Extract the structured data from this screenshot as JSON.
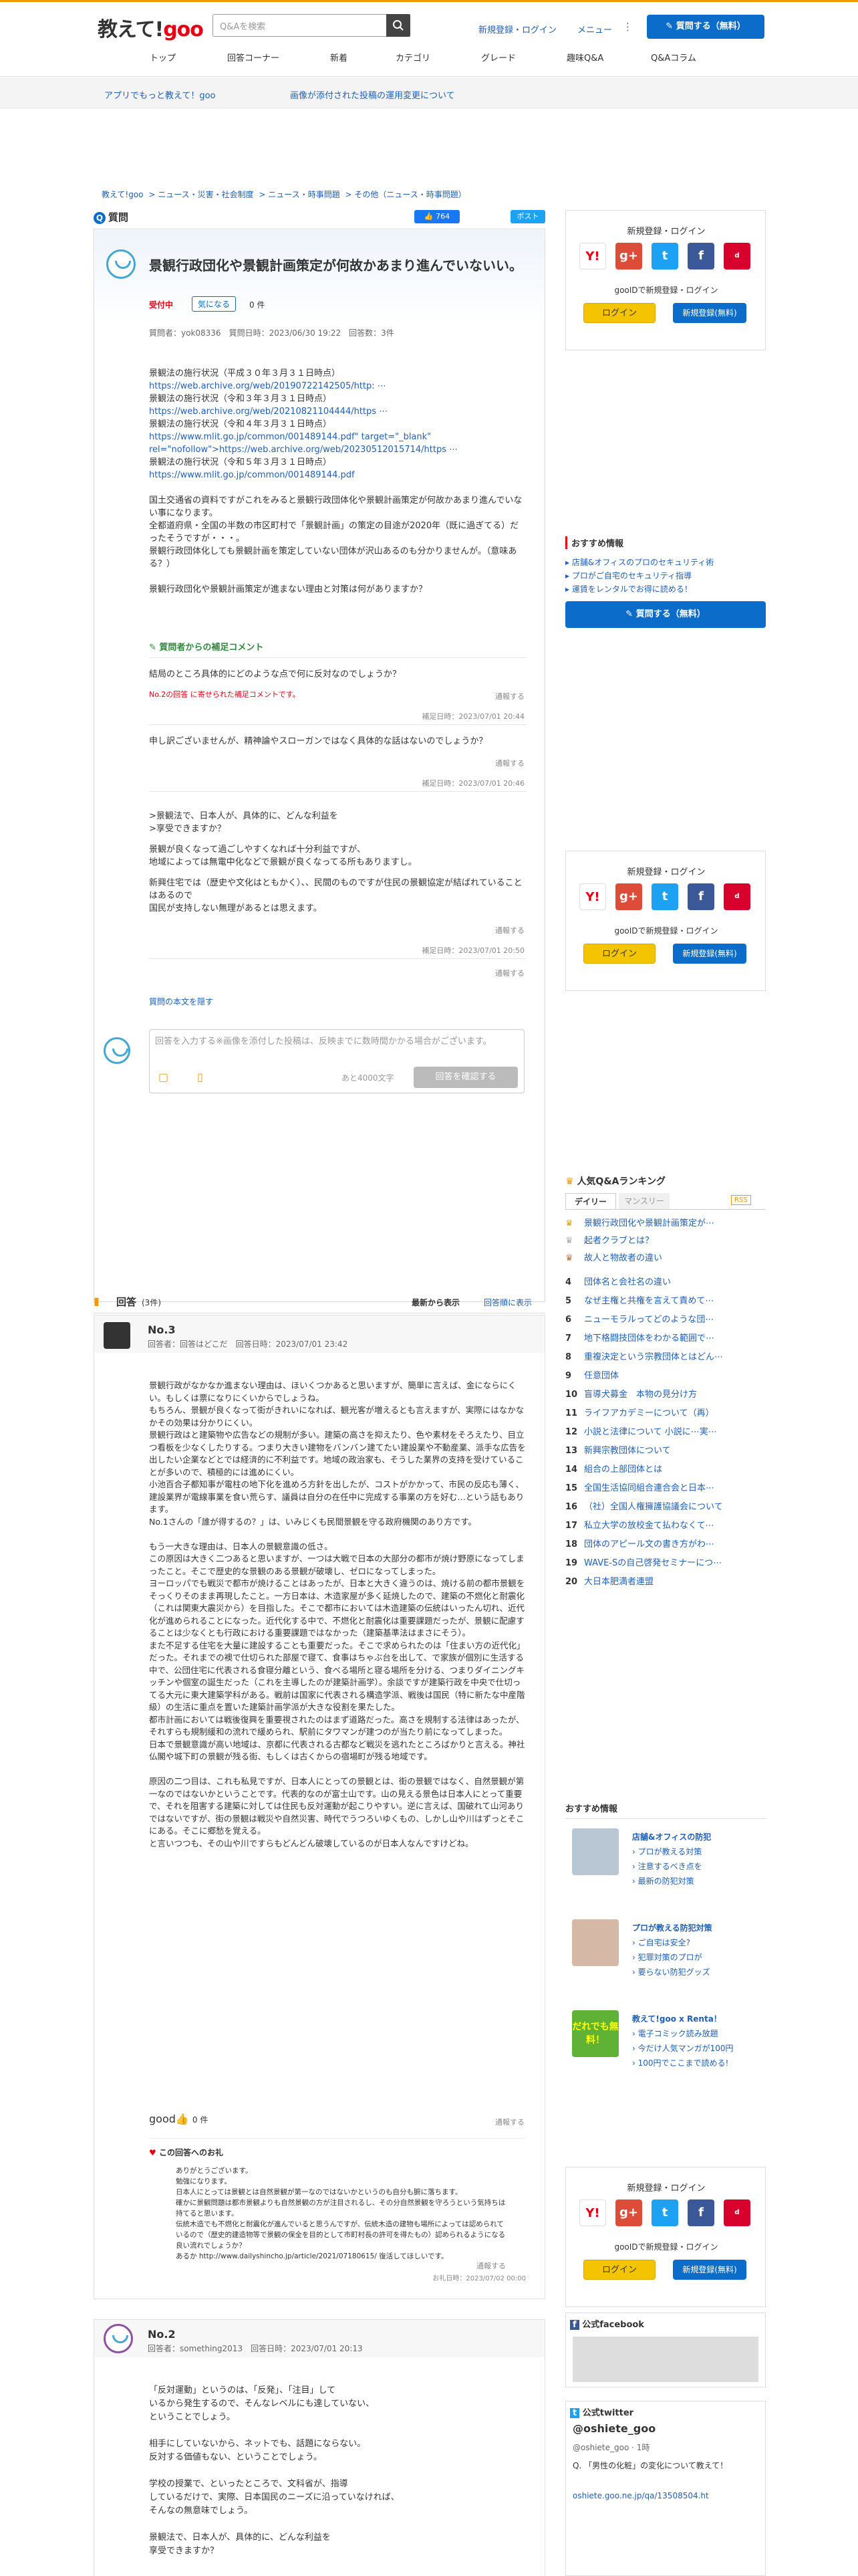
{
  "header": {
    "logo_text": "教えて!",
    "logo_goo": "goo",
    "search_placeholder": "Q&Aを検索",
    "register": "新規登録・ログイン",
    "menu": "メニュー",
    "ask_button": "質問する（無料）"
  },
  "nav": [
    "トップ",
    "回答コーナー",
    "新着",
    "カテゴリ",
    "グレード",
    "趣味Q&A",
    "Q&Aコラム"
  ],
  "subbar": {
    "app": "アプリでもっと教えて！goo",
    "notice": "画像が添付された投稿の運用変更について"
  },
  "breadcrumb": [
    "教えて!goo",
    "ニュース・災害・社会制度",
    "ニュース・時事問題",
    "その他（ニュース・時事問題）"
  ],
  "question": {
    "label": "質問",
    "like_count": "764",
    "share": "ポスト",
    "title": "景観行政団化や景観計画策定が何故かあまり進んでいないい。",
    "status": "受付中",
    "follow": "気になる",
    "follow_count": "0 件",
    "meta": "質問者：yok08336　質問日時：2023/06/30 19:22　回答数：3件",
    "body": [
      "景観法の施行状況（平成３０年３月３１日時点）",
      "https://web.archive.org/web/20190722142505/http: ⋯",
      "景観法の施行状況（令和３年３月３１日時点）",
      "https://web.archive.org/web/20210821104444/https ⋯",
      "景観法の施行状況（令和４年３月３１日時点）",
      "https://www.mlit.go.jp/common/001489144.pdf\" target=\"_blank\" rel=\"nofollow\">https://web.archive.org/web/20230512015714/https ⋯",
      "景観法の施行状況（令和５年３月３１日時点）",
      "https://www.mlit.go.jp/common/001489144.pdf",
      "",
      "国土交通省の資料ですがこれをみると景観行政団体化や景観計画策定が何故かあまり進んでいない事になります。",
      "全都道府県・全国の半数の市区町村で「景観計画」の策定の目途が2020年（既に過ぎてる）だったそうですが・・・。",
      "景観行政団体化しても景観計画を策定していない団体が沢山あるのも分かりませんが。（意味ある？）",
      "",
      "景観行政団化や景観計画策定が進まない理由と対策は何がありますか？"
    ],
    "supplement_title": "質問者からの補足コメント",
    "supp1": "結局のところ具体的にどのような点で何に反対なのでしょうか？",
    "supp1_note": "No.2の回答 に寄せられた補足コメントです。",
    "report": "通報する",
    "date1": "補足日時：2023/07/01 20:44",
    "supp2": "申し訳ございませんが、精神論やスローガンではなく具体的な話はないのでしょうか？",
    "date2": "補足日時：2023/07/01 20:46",
    "supp3": [
      ">景観法で、日本人が、具体的に、どんな利益を",
      ">享受できますか？",
      "",
      "景観が良くなって過ごしやすくなれば十分利益ですが、",
      "地域によっては無電中化などで景観が良くなってる所もありますし。",
      "",
      "新興住宅では（歴史や文化はともかく）、、民間のものですが住民の景観協定が結ばれていることはあるので",
      "国民が支持しない無理があるとは思えます。"
    ],
    "date3": "補足日時：2023/07/01 20:50",
    "copy_link": "質問の本文を隠す",
    "answer_placeholder": "回答を入力する※画像を添付した投稿は、反映までに数時間かかる場合がございます。",
    "char_count": "あと4000文字",
    "answer_button": "回答を確認する"
  },
  "sidebar": {
    "login_title": "新規登録・ログイン",
    "gooid": "gooIDで新規登録・ログイン",
    "login": "ログイン",
    "register": "新規登録(無料)",
    "recommend_title": "おすすめ情報",
    "recommend": [
      "店舗&オフィスのプロのセキュリティ術",
      "プロがご自宅のセキュリティ指導",
      "運賃をレンタルでお得に読める！"
    ],
    "ask_button": "質問する（無料）",
    "ranking_title": "人気Q&Aランキング",
    "tab_daily": "デイリー",
    "tab_monthly": "マンスリー",
    "rss": "RSS",
    "ranking": [
      "景観行政団化や景観計画策定が⋯",
      "起者クラブとは？",
      "故人と物故者の違い",
      "団体名と会社名の違い",
      "なぜ主権と共権を言えて責めて⋯",
      "ニューモラルってどのような団⋯",
      "地下格闘技団体をわかる範囲で⋯",
      "重複決定という宗教団体とはどん⋯",
      "任意団体",
      "盲導犬募金　本物の見分け方",
      "ライフアカデミーについて（再）",
      "小説と法律について 小説に⋯実⋯",
      "新興宗教団体について",
      "組合の上部団体とは",
      "全国生活協同組合連合会と日本⋯",
      "（社）全国人権擁護協議会について",
      "私立大学の放校金て払わなくて⋯",
      "団体のアピール文の書き方がわ⋯",
      "WAVE-Sの自己啓発セミナーにつ⋯",
      "大日本肥満者連盟"
    ],
    "info_title": "おすすめ情報",
    "info": [
      {
        "head": "店舗&オフィスの防犯",
        "items": [
          "プロが教える対策",
          "注意するべき点を",
          "最新の防犯対策"
        ]
      },
      {
        "head": "プロが教える防犯対策",
        "items": [
          "ご自宅は安全?",
          "犯罪対策のプロが",
          "要らない防犯グッズ"
        ]
      },
      {
        "head": "教えて!goo x Renta！",
        "items": [
          "電子コミック読み放題",
          "今だけ人気マンガが100円",
          "100円でここまで読める!"
        ]
      }
    ],
    "ad_badge": "だれでも無料！",
    "fb_title": "公式facebook",
    "tw_title": "公式twitter",
    "tw_name": "@oshiete_goo",
    "tw_handle": "@oshiete_goo · 1時",
    "tw_text": "Q. 「男性の化粧」の変化について教えて！",
    "tw_url": "oshiete.goo.ne.jp/qa/13508504.ht"
  },
  "answers": {
    "title": "回答",
    "count": "(3件)",
    "sort1": "最新から表示",
    "sort2": "回答順に表示",
    "a3": {
      "no": "No.3",
      "meta": "回答者：回答はどこだ　回答日時：2023/07/01 23:42",
      "body": "景観行政がなかなか進まない理由は、ほいくつかあると思いますが、簡単に言えば、金にならにくい。もしくは票になりにくいからでしょうね。\nもちろん、景観が良くなって街がきれいになれば、観光客が増えるとも言えますが、実際にはなかなかその効果は分かりにくい。\n景観行政はと建築物や広告などの規制が多い。建築の高さを抑えたり、色や素材をそろえたり、目立つ看板を少なくしたりする。つまり大きい建物をバンバン建てたい建設業や不動産業、派手な広告を出したい企業などとでは経済的に不利益です。地域の政治家も、そうした業界の支持を受けていることが多いので、積極的には進めにくい。\n小池百合子都知事が電柱の地下化を進めろ方針を出したが、コストがかかって、市民の反応も薄く、建設業界が電線事業を食い荒らす、議員は自分の在任中に完成する事業の方を好む…という話もあります。\nNo.1さんの「誰が得するの？」は、いみじくも民間景観を守る政府機関のあり方です。\n\nもう一大きな理由は、日本人の景観意識の低さ。\nこの原因は大きく二つあると思いますが、一つは大戦で日本の大部分の都市が焼け野原になってしまったこと。そこで歴史的な景観のある景観が破壊し、ゼロになってしまった。\nヨーロッパでも戦災で都市が焼けることはあったが、日本と大きく違うのは、焼ける前の都市景観をそっくりそのまま再現したこと。一方日本は、木造家屋が多く延焼したので、建築の不燃化と耐震化（これは関東大震災から）を目指した。そこで都市においては木造建築の伝統はいったん切れ、近代化が進められることになった。近代化する中で、不燃化と耐震化は重要課題だったが、景観に配慮することは少なくとも行政における重要課題ではなかった（建築基準法はまさにそう）。\nまた不足する住宅を大量に建設することも重要だった。そこで求められたのは「住まい方の近代化」だった。それまでの襖で仕切られた部屋で寝て、食事はちゃぶ台を出して、で家族が個別に生活する中で、公団住宅に代表される食寝分離という、食べる場所と寝る場所を分ける、つまりダイニングキッチンや個室の誕生だった（これを主導したのが建築計画学）。余談ですが建築行政を中央で仕切ってる大元に東大建築学科がある。戦前は国家に代表される構造学派、戦後は国民（特に新たな中産階級）の生活に重点を置いた建築計画学派が大きな役割を果たした。\n都市計画においては戦後復興を重要視されたのはまず道路だった。高さを規制する法律はあったが、それすらも規制緩和の流れで緩められ、駅前にタワマンが建つのが当たり前になってしまった。\n日本で景観意識が高い地域は、京都に代表される古都など戦災を逃れたところばかりと言える。神社仏閣や城下町の景観が残る街、もしくは古くからの宿場町が残る地域です。\n\n原因の二つ目は、これも私見ですが、日本人にとっての景観とは、街の景観ではなく、自然景観が第一なのではないかということです。代表的なのが富士山です。山の見える景色は日本人にとって重要で、それを阻害する建築に対しては住民も反対運動が起こりやすい。逆に言えば、国破れて山河ありではないですが、街の景観は戦災や自然災害、時代でうつろいゆくもの、しかし山や川はずっとそこにある。そこに郷愁を覚える。\nと言いつつも、その山や川ですらもどんどん破壊しているのが日本人なんですけどね。",
      "good": "good",
      "good_count": "0 件",
      "thanks_title": "この回答へのお礼",
      "thanks": "ありがとうございます。\n勉強になります。\n日本人にとっては景観とは自然景観が第一なのではないかというのも自分も腑に落ちます。\n確かに景観問題は都市景観よりも自然景観の方が注目されるし、その分自然景観を守ろうという気持ちは持てると思います。\n伝統木造でも不燃化と耐震化が進んでいると思うんですが、伝統木造の建物も場所によっては認められているので（歴史的建造物等で景観の保全を目的として市町村長の許可を得たもの）認められるようになる良い流れでしょうか？\nあるか http://www.dailyshincho.jp/article/2021/07180615/ 復活してほしいです。",
      "thanks_date": "お礼日時：2023/07/02 00:00"
    },
    "a2": {
      "no": "No.2",
      "meta": "回答者：something2013　回答日時：2023/07/01 20:13",
      "body": "「反対運動」というのは、「反発」、「注目」して\nいるから発生するので、そんなレベルにも達していない、\nということでしょう。\n\n相手にしていないから、ネットでも、話題にならない。\n反対する価値もない、ということでしょう。\n\n学校の授業で、といったところで、文科省が、指導\nしているだけで、実際、日本国民のニーズに沿っていなければ、\nそんなの無意味でしょう。\n\n景観法で、日本人が、具体的に、どんな利益を\n享受できますか？"
    }
  }
}
